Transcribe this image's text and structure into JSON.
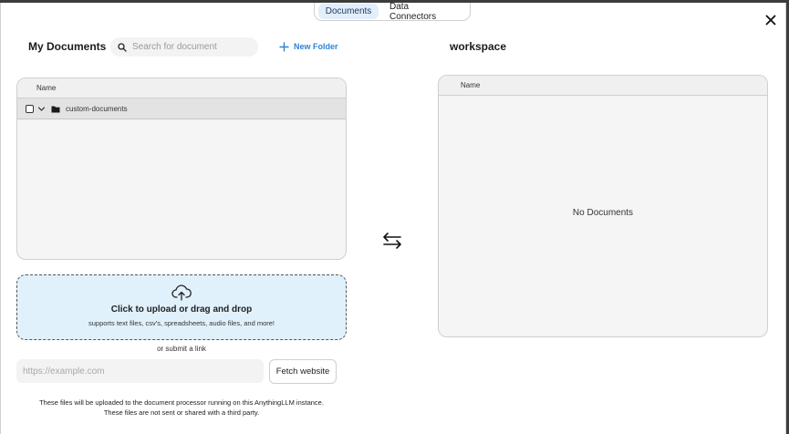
{
  "tabs": [
    {
      "label": "Documents",
      "active": true
    },
    {
      "label": "Data Connectors",
      "active": false
    }
  ],
  "my_documents": {
    "title": "My Documents",
    "search_placeholder": "Search for document",
    "new_folder_label": "New Folder",
    "column_header": "Name",
    "folders": [
      {
        "name": "custom-documents",
        "icon": "folder-icon",
        "checked": false
      }
    ]
  },
  "upload": {
    "icon": "cloud-upload-icon",
    "title": "Click to upload or drag and drop",
    "subtitle": "supports text files, csv's, spreadsheets, audio files, and more!",
    "or_link": "or submit a link",
    "url_placeholder": "https://example.com",
    "fetch_label": "Fetch website",
    "footnote_line1": "These files will be uploaded to the document processor running on this AnythingLLM instance.",
    "footnote_line2": "These files are not sent or shared with a third party."
  },
  "workspace": {
    "title": "workspace",
    "column_header": "Name",
    "empty_message": "No Documents"
  },
  "colors": {
    "accent": "#2f84d6",
    "upload_bg": "#e0f1fc",
    "tab_active_bg": "#e2eefb"
  }
}
